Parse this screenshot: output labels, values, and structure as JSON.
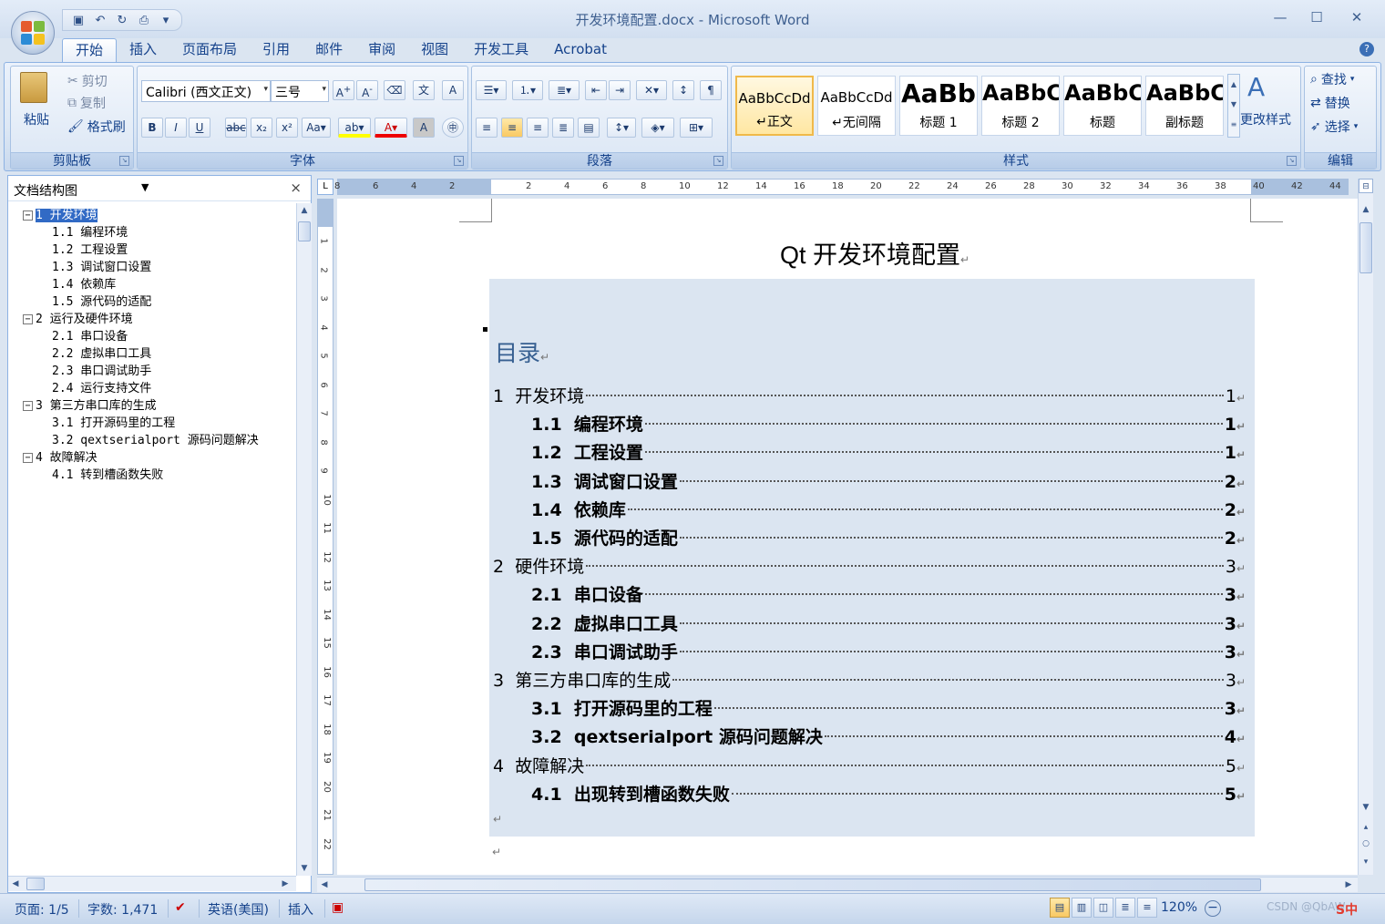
{
  "window": {
    "title": "开发环境配置.docx - Microsoft Word",
    "minimize": "—",
    "maximize": "☐",
    "close": "✕"
  },
  "qat": {
    "save_icon": "save-icon",
    "undo_icon": "undo-icon",
    "redo_icon": "redo-icon",
    "preview_icon": "print-preview-icon",
    "more": "▾"
  },
  "tabs": [
    "开始",
    "插入",
    "页面布局",
    "引用",
    "邮件",
    "审阅",
    "视图",
    "开发工具",
    "Acrobat"
  ],
  "ribbon": {
    "clipboard": {
      "label": "剪贴板",
      "paste": "粘贴",
      "cut": "剪切",
      "copy": "复制",
      "format_painter": "格式刷"
    },
    "font": {
      "label": "字体",
      "font_name": "Calibri (西文正文)",
      "font_size": "三号"
    },
    "paragraph": {
      "label": "段落"
    },
    "styles": {
      "label": "样式",
      "items": [
        {
          "sample": "AaBbCcDd",
          "name": "↵正文"
        },
        {
          "sample": "AaBbCcDd",
          "name": "↵无间隔"
        },
        {
          "sample": "AaBb",
          "name": "标题 1"
        },
        {
          "sample": "AaBbC",
          "name": "标题 2"
        },
        {
          "sample": "AaBbC",
          "name": "标题"
        },
        {
          "sample": "AaBbC",
          "name": "副标题"
        }
      ],
      "change_styles": "更改样式"
    },
    "editing": {
      "label": "编辑",
      "find": "查找",
      "replace": "替换",
      "select": "选择"
    }
  },
  "docmap": {
    "title": "文档结构图",
    "close": "×",
    "nodes": [
      {
        "level": 1,
        "text": "1 开发环境",
        "highlight": true
      },
      {
        "level": 2,
        "text": "1.1 编程环境"
      },
      {
        "level": 2,
        "text": "1.2 工程设置"
      },
      {
        "level": 2,
        "text": "1.3 调试窗口设置"
      },
      {
        "level": 2,
        "text": "1.4 依赖库"
      },
      {
        "level": 2,
        "text": "1.5 源代码的适配"
      },
      {
        "level": 1,
        "text": "2 运行及硬件环境"
      },
      {
        "level": 2,
        "text": "2.1 串口设备"
      },
      {
        "level": 2,
        "text": "2.2 虚拟串口工具"
      },
      {
        "level": 2,
        "text": "2.3 串口调试助手"
      },
      {
        "level": 2,
        "text": "2.4 运行支持文件"
      },
      {
        "level": 1,
        "text": "3 第三方串口库的生成"
      },
      {
        "level": 2,
        "text": "3.1 打开源码里的工程"
      },
      {
        "level": 2,
        "text": "3.2 qextserialport 源码问题解决"
      },
      {
        "level": 1,
        "text": "4 故障解决"
      },
      {
        "level": 2,
        "text": "4.1 转到槽函数失败"
      }
    ]
  },
  "ruler": {
    "corner": "L",
    "h_labels": [
      "8",
      "6",
      "4",
      "2",
      "2",
      "4",
      "6",
      "8",
      "10",
      "12",
      "14",
      "16",
      "18",
      "20",
      "22",
      "24",
      "26",
      "28",
      "30",
      "32",
      "34",
      "36",
      "38",
      "40",
      "42",
      "44"
    ],
    "v_labels": [
      "1",
      "2",
      "3",
      "4",
      "5",
      "6",
      "7",
      "8",
      "9",
      "10",
      "11",
      "12",
      "13",
      "14",
      "15",
      "16",
      "17",
      "18",
      "19",
      "20",
      "21",
      "22"
    ]
  },
  "document": {
    "title": "Qt 开发环境配置",
    "toc_heading": "目录",
    "toc": [
      {
        "level": 1,
        "num": "1",
        "text": "开发环境",
        "page": "1"
      },
      {
        "level": 2,
        "num": "1.1",
        "text": "编程环境",
        "page": "1"
      },
      {
        "level": 2,
        "num": "1.2",
        "text": "工程设置",
        "page": "1"
      },
      {
        "level": 2,
        "num": "1.3",
        "text": "调试窗口设置",
        "page": "2"
      },
      {
        "level": 2,
        "num": "1.4",
        "text": "依赖库",
        "page": "2"
      },
      {
        "level": 2,
        "num": "1.5",
        "text": "源代码的适配",
        "page": "2"
      },
      {
        "level": 1,
        "num": "2",
        "text": "硬件环境",
        "page": "3"
      },
      {
        "level": 2,
        "num": "2.1",
        "text": "串口设备",
        "page": "3"
      },
      {
        "level": 2,
        "num": "2.2",
        "text": "虚拟串口工具",
        "page": "3"
      },
      {
        "level": 2,
        "num": "2.3",
        "text": "串口调试助手",
        "page": "3"
      },
      {
        "level": 1,
        "num": "3",
        "text": "第三方串口库的生成",
        "page": "3"
      },
      {
        "level": 2,
        "num": "3.1",
        "text": "打开源码里的工程",
        "page": "3"
      },
      {
        "level": 2,
        "num": "3.2",
        "text": "qextserialport 源码问题解决",
        "page": "4"
      },
      {
        "level": 1,
        "num": "4",
        "text": "故障解决",
        "page": "5"
      },
      {
        "level": 2,
        "num": "4.1",
        "text": "出现转到槽函数失败",
        "page": "5"
      }
    ],
    "para_mark": "↵"
  },
  "status": {
    "page": "页面: 1/5",
    "words": "字数: 1,471",
    "language": "英语(美国)",
    "mode": "插入",
    "zoom": "120%",
    "watermark": "CSDN @QbAW"
  }
}
